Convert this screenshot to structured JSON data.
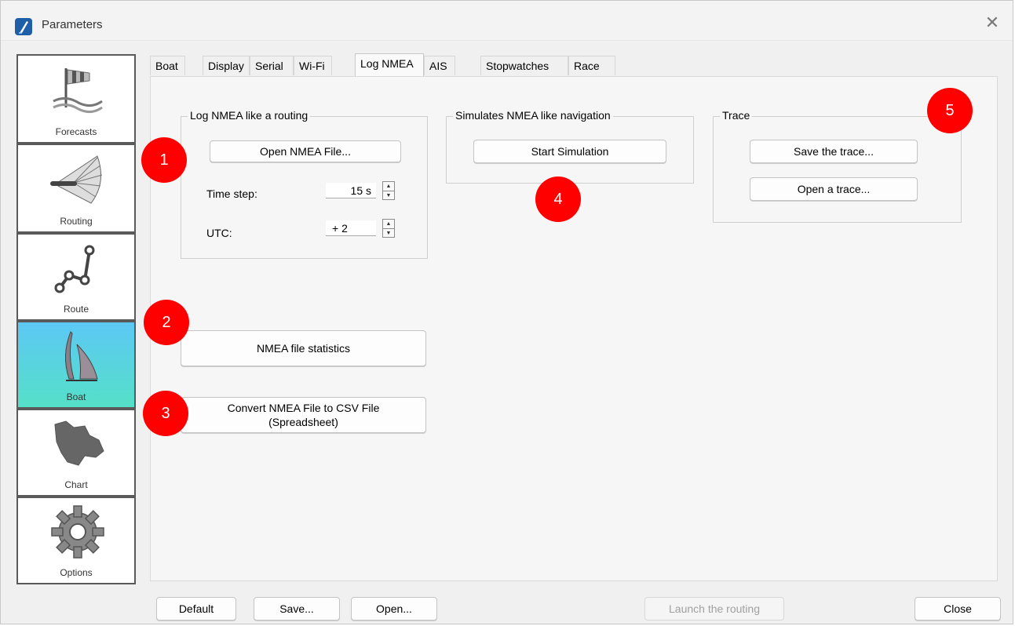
{
  "window": {
    "title": "Parameters",
    "close_glyph": "✕"
  },
  "sidebar": {
    "items": [
      {
        "label": "Forecasts",
        "icon": "windsock-icon"
      },
      {
        "label": "Routing",
        "icon": "routing-fan-icon"
      },
      {
        "label": "Route",
        "icon": "route-nodes-icon"
      },
      {
        "label": "Boat",
        "icon": "sailboat-icon",
        "active": true
      },
      {
        "label": "Chart",
        "icon": "map-region-icon"
      },
      {
        "label": "Options",
        "icon": "gear-icon"
      }
    ]
  },
  "tabs": [
    {
      "label": "Boat"
    },
    {
      "label": "Display"
    },
    {
      "label": "Serial"
    },
    {
      "label": "Wi-Fi"
    },
    {
      "label": "Log NMEA",
      "active": true
    },
    {
      "label": "AIS"
    },
    {
      "label": "Stopwatches"
    },
    {
      "label": "Race"
    }
  ],
  "log_group": {
    "title": "Log NMEA like a routing",
    "open_button": "Open NMEA File...",
    "time_step_label": "Time step:",
    "time_step_value": "15 s",
    "utc_label": "UTC:",
    "utc_value": "+ 2"
  },
  "sim_group": {
    "title": "Simulates NMEA like navigation",
    "start_button": "Start Simulation"
  },
  "trace_group": {
    "title": "Trace",
    "save_button": "Save the trace...",
    "open_button": "Open a trace..."
  },
  "stats_button": "NMEA file statistics",
  "convert_button": {
    "line1": "Convert NMEA File to CSV File",
    "line2": "(Spreadsheet)"
  },
  "badges": [
    "1",
    "2",
    "3",
    "4",
    "5"
  ],
  "footer": {
    "default": "Default",
    "save": "Save...",
    "open": "Open...",
    "launch": "Launch the routing",
    "close": "Close"
  },
  "colors": {
    "badge": "#ff0000",
    "active_sidebar_top": "#5cc8f4",
    "active_sidebar_bottom": "#55e0c8"
  }
}
